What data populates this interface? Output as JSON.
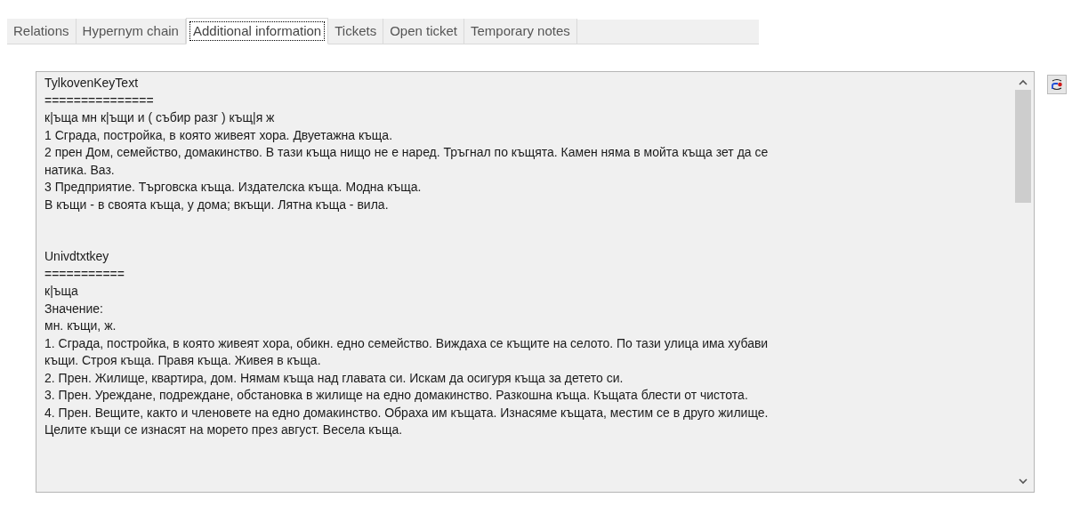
{
  "tabs": [
    {
      "label": "Relations",
      "selected": false
    },
    {
      "label": "Hypernym chain",
      "selected": false
    },
    {
      "label": "Additional information",
      "selected": true
    },
    {
      "label": "Tickets",
      "selected": false
    },
    {
      "label": "Open ticket",
      "selected": false
    },
    {
      "label": "Temporary notes",
      "selected": false
    }
  ],
  "text_sections": [
    {
      "lines": [
        "TylkovenKeyText",
        "===============",
        "к|ъща мн к|ъщи и ( събир разг ) къщ|я ж",
        "1 Сграда, постройка, в която живеят хора. Двуетажна къща.",
        "2 прен Дом, семейство, домакинство. В тази къща нищо не е наред. Тръгнал по къщята. Камен няма в мойта къща зет да се",
        "натика. Ваз.",
        "3 Предприятие. Търговска къща. Издателска къща. Модна къща.",
        "В къщи - в своята къща, у дома; вкъщи. Лятна къща - вила."
      ]
    },
    {
      "lines": [
        "Univdtxtkey",
        "===========",
        "к|ъща",
        "Значение:",
        "мн. къщи, ж.",
        "1. Сграда, постройка, в която живеят хора, обикн. едно семейство. Виждаха се къщите на селото. По тази улица има хубави",
        "къщи. Строя къща. Правя къща. Живея в къща.",
        "2. Прен. Жилище, квартира, дом. Нямам къща над главата си. Искам да осигуря къща за детето си.",
        "3. Прен. Уреждане, подреждане, обстановка в жилище на едно домакинство. Разкошна къща. Къщата блести от чистота.",
        "4. Прен. Вещите, както и членовете на едно домакинство. Обраха им къщата. Изнасяме къщата, местим се в друго жилище.",
        "Целите къщи се изнасят на морето през август. Весела къща."
      ]
    }
  ]
}
